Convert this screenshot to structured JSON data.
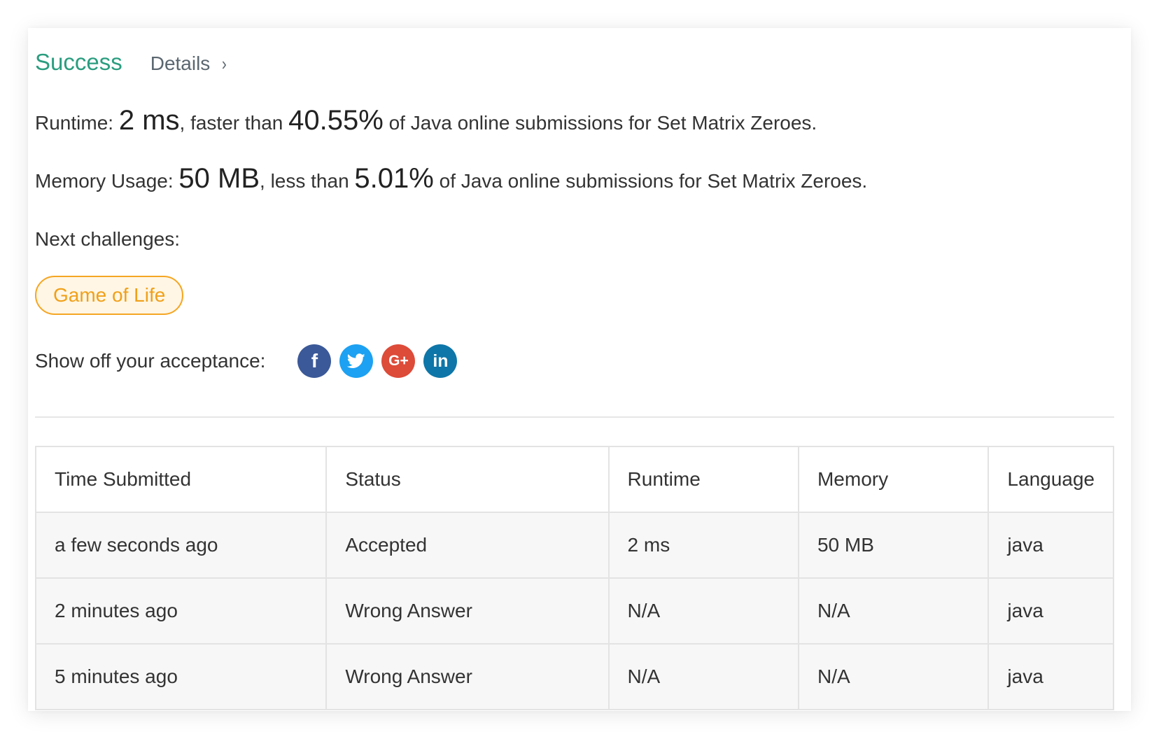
{
  "header": {
    "status": "Success",
    "details_label": "Details",
    "chevron": "›"
  },
  "runtime": {
    "label": "Runtime: ",
    "value": "2 ms",
    "middle": ", faster than ",
    "percent": "40.55%",
    "suffix": " of Java online submissions for Set Matrix Zeroes."
  },
  "memory": {
    "label": "Memory Usage: ",
    "value": "50 MB",
    "middle": ", less than ",
    "percent": "5.01%",
    "suffix": " of Java online submissions for Set Matrix Zeroes."
  },
  "next": {
    "label": "Next challenges:",
    "challenges": [
      "Game of Life"
    ]
  },
  "share": {
    "label": "Show off your acceptance:",
    "icons": [
      {
        "name": "facebook-icon",
        "glyph": "f",
        "color": "#3b5998"
      },
      {
        "name": "twitter-icon",
        "glyph": "",
        "color": "#1da1f2"
      },
      {
        "name": "google-plus-icon",
        "glyph": "G+",
        "color": "#dd4b39"
      },
      {
        "name": "linkedin-icon",
        "glyph": "in",
        "color": "#0e76a8"
      }
    ]
  },
  "table": {
    "headers": [
      "Time Submitted",
      "Status",
      "Runtime",
      "Memory",
      "Language"
    ],
    "rows": [
      {
        "time": "a few seconds ago",
        "status": "Accepted",
        "runtime": "2 ms",
        "memory": "50 MB",
        "language": "java"
      },
      {
        "time": "2 minutes ago",
        "status": "Wrong Answer",
        "runtime": "N/A",
        "memory": "N/A",
        "language": "java"
      },
      {
        "time": "5 minutes ago",
        "status": "Wrong Answer",
        "runtime": "N/A",
        "memory": "N/A",
        "language": "java"
      }
    ]
  },
  "colors": {
    "success": "#2a9d7f",
    "wrong": "#c0282d",
    "challenge": "#f0a019"
  }
}
